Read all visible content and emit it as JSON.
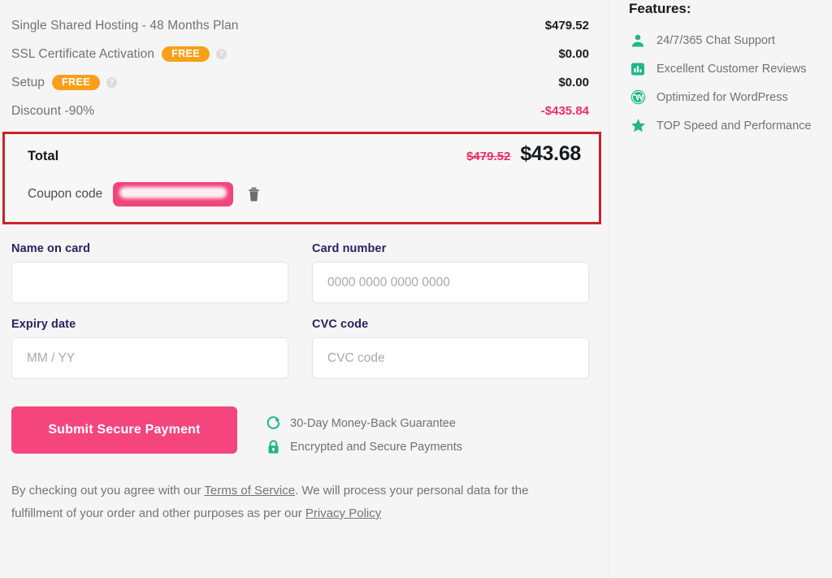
{
  "colors": {
    "accent_pink": "#F4467D",
    "badge_orange": "#F9A01B",
    "highlight_red": "#CC2229",
    "feature_green": "#21B68A",
    "label_navy": "#2B2360",
    "discount_pink": "#EC2F63",
    "page_background": "#F5F5F5"
  },
  "order_summary": {
    "lines": [
      {
        "label": "Single Shared Hosting - 48 Months Plan",
        "badge": "",
        "has_info": false,
        "amount": "$479.52",
        "negative": false
      },
      {
        "label": "SSL Certificate Activation",
        "badge": "FREE",
        "has_info": true,
        "amount": "$0.00",
        "negative": false
      },
      {
        "label": "Setup",
        "badge": "FREE",
        "has_info": true,
        "amount": "$0.00",
        "negative": false
      },
      {
        "label": "Discount -90%",
        "badge": "",
        "has_info": false,
        "amount": "-$435.84",
        "negative": true
      }
    ],
    "info_icon_glyph": "?"
  },
  "total_box": {
    "total_label": "Total",
    "original_price": "$479.52",
    "final_price": "$43.68",
    "coupon_label": "Coupon code",
    "coupon_value": "",
    "coupon_masked": true,
    "delete_icon": "trash-icon"
  },
  "card_form": {
    "fields": [
      {
        "name": "name-on-card",
        "label": "Name on card",
        "value": "",
        "placeholder": ""
      },
      {
        "name": "card-number",
        "label": "Card number",
        "value": "",
        "placeholder": "0000 0000 0000 0000"
      },
      {
        "name": "expiry-date",
        "label": "Expiry date",
        "value": "",
        "placeholder": "MM / YY"
      },
      {
        "name": "cvc-code",
        "label": "CVC code",
        "value": "",
        "placeholder": "CVC code"
      }
    ]
  },
  "submit": {
    "button_label": "Submit Secure Payment",
    "trust_items": [
      {
        "icon": "refresh-circle-icon",
        "text": "30-Day Money-Back Guarantee"
      },
      {
        "icon": "lock-icon",
        "text": "Encrypted and Secure Payments"
      }
    ]
  },
  "legal": {
    "part1": "By checking out you agree with our ",
    "terms_link": "Terms of Service",
    "part2": ". We will process your personal data for the fulfillment of your order and other purposes as per our ",
    "privacy_link": "Privacy Policy"
  },
  "sidebar": {
    "title": "Features:",
    "items": [
      {
        "icon": "person-icon",
        "text": "24/7/365 Chat Support"
      },
      {
        "icon": "bar-chart-icon",
        "text": "Excellent Customer Reviews"
      },
      {
        "icon": "wordpress-icon",
        "text": "Optimized for WordPress"
      },
      {
        "icon": "star-icon",
        "text": "TOP Speed and Performance"
      }
    ]
  }
}
